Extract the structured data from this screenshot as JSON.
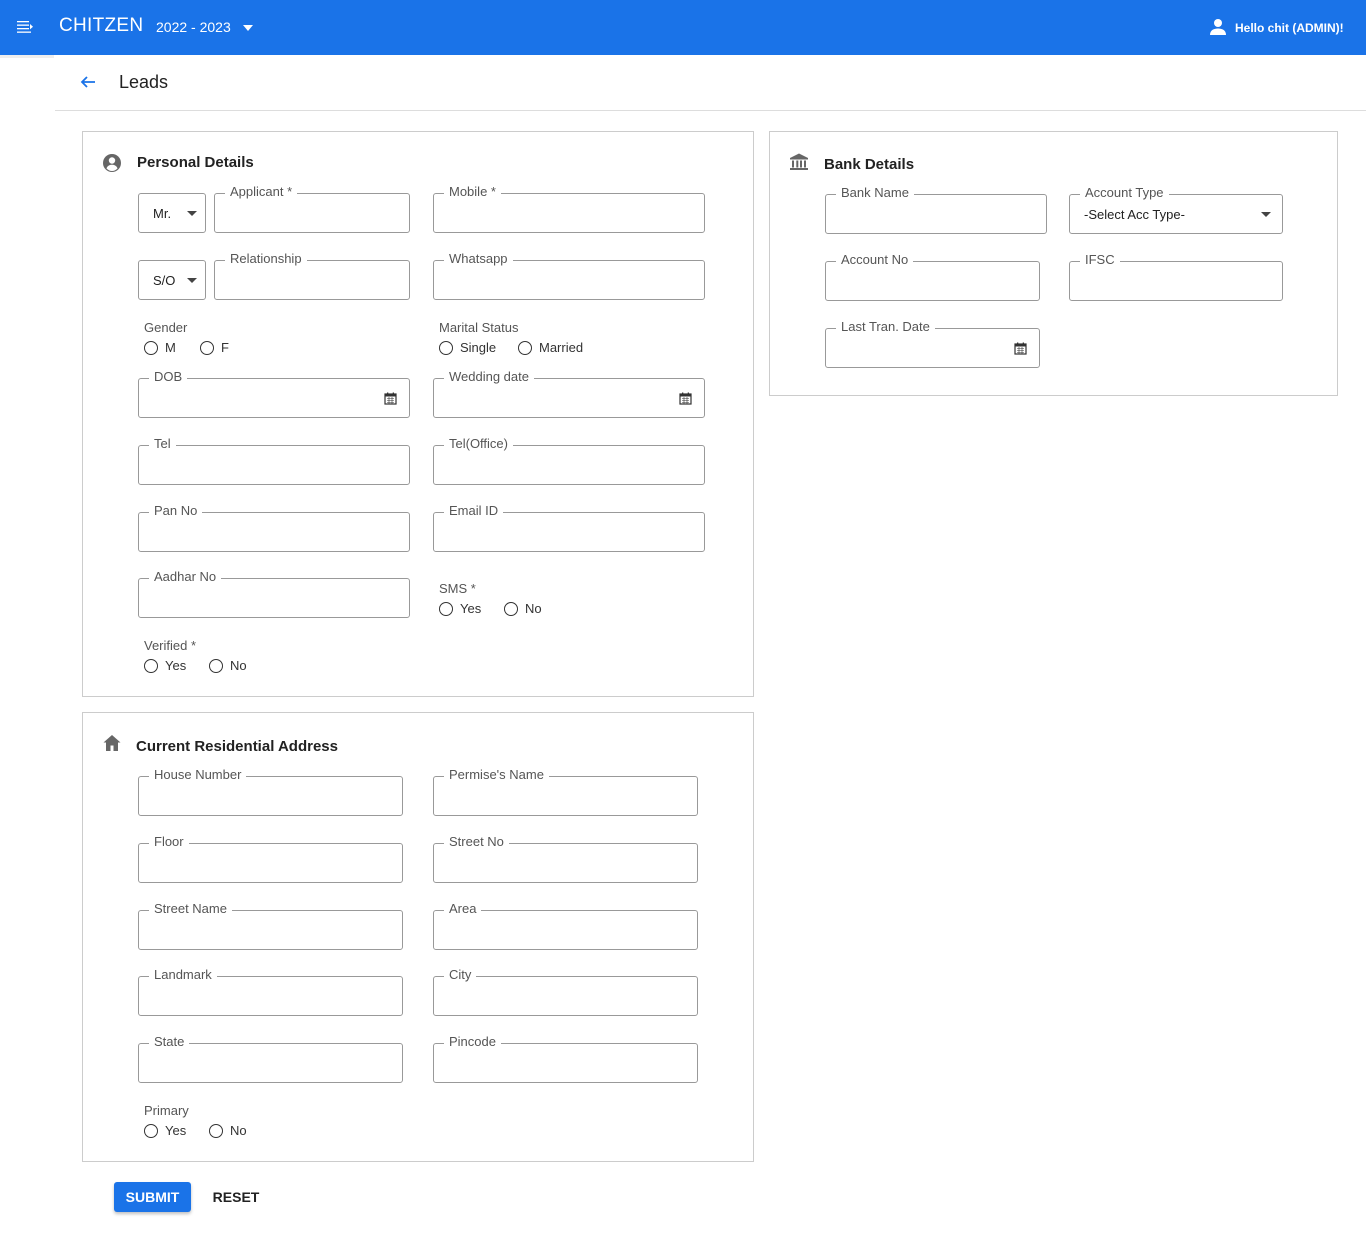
{
  "app": {
    "brand": "CHITZEN",
    "year": "2022 - 2023",
    "user_greeting": "Hello chit (ADMIN)!"
  },
  "page": {
    "title": "Leads"
  },
  "personal": {
    "title": "Personal Details",
    "salutation": "Mr.",
    "relation_prefix": "S/O",
    "applicant_label": "Applicant *",
    "mobile_label": "Mobile *",
    "relationship_label": "Relationship",
    "whatsapp_label": "Whatsapp",
    "gender": {
      "label": "Gender",
      "options": [
        "M",
        "F"
      ]
    },
    "marital": {
      "label": "Marital Status",
      "options": [
        "Single",
        "Married"
      ]
    },
    "dob_label": "DOB",
    "wedding_label": "Wedding date",
    "tel_label": "Tel",
    "tel_office_label": "Tel(Office)",
    "pan_label": "Pan No",
    "email_label": "Email ID",
    "aadhar_label": "Aadhar No",
    "sms": {
      "label": "SMS *",
      "options": [
        "Yes",
        "No"
      ]
    },
    "verified": {
      "label": "Verified *",
      "options": [
        "Yes",
        "No"
      ]
    }
  },
  "bank": {
    "title": "Bank Details",
    "bank_name_label": "Bank Name",
    "account_type_label": "Account Type",
    "account_type_value": "-Select Acc Type-",
    "account_no_label": "Account No",
    "ifsc_label": "IFSC",
    "last_tran_label": "Last Tran. Date"
  },
  "address": {
    "title": "Current Residential Address",
    "house_label": "House Number",
    "premise_label": "Permise's Name",
    "floor_label": "Floor",
    "street_no_label": "Street No",
    "street_name_label": "Street Name",
    "area_label": "Area",
    "landmark_label": "Landmark",
    "city_label": "City",
    "state_label": "State",
    "pincode_label": "Pincode",
    "primary": {
      "label": "Primary",
      "options": [
        "Yes",
        "No"
      ]
    }
  },
  "actions": {
    "submit": "SUBMIT",
    "reset": "RESET"
  }
}
